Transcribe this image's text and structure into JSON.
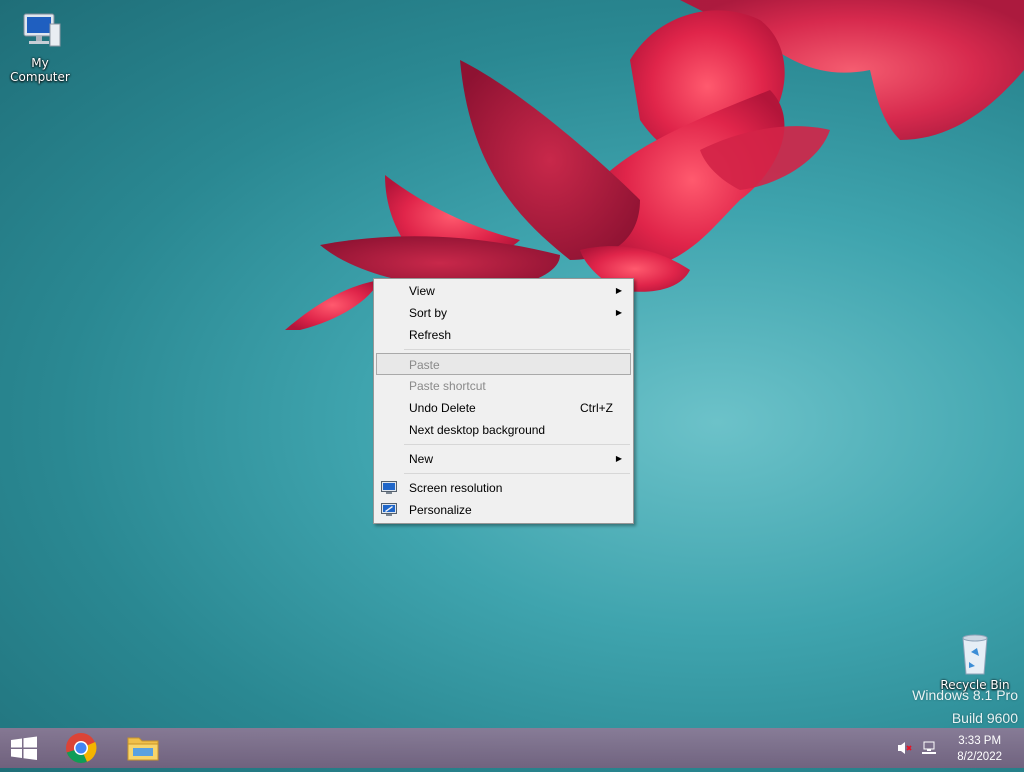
{
  "desktop": {
    "icons": [
      {
        "label": "My Computer"
      },
      {
        "label": "Recycle Bin"
      }
    ],
    "watermark": {
      "line1": "Windows 8.1 Pro",
      "line2": "Build 9600"
    }
  },
  "context_menu": {
    "items": [
      {
        "label": "View",
        "submenu": true
      },
      {
        "label": "Sort by",
        "submenu": true
      },
      {
        "label": "Refresh"
      },
      {
        "label": "Paste",
        "disabled": true,
        "highlighted": true
      },
      {
        "label": "Paste shortcut",
        "disabled": true
      },
      {
        "label": "Undo Delete",
        "shortcut": "Ctrl+Z"
      },
      {
        "label": "Next desktop background"
      },
      {
        "label": "New",
        "submenu": true
      },
      {
        "label": "Screen resolution",
        "icon": "monitor-icon"
      },
      {
        "label": "Personalize",
        "icon": "personalize-monitor-icon"
      }
    ],
    "submenu_arrow": "▶"
  },
  "taskbar": {
    "buttons": [
      {
        "name": "start",
        "icon": "windows-logo-icon"
      },
      {
        "name": "chrome",
        "icon": "chrome-icon"
      },
      {
        "name": "file-explorer",
        "icon": "folder-icon"
      }
    ],
    "tray": {
      "volume_icon": "volume-muted-icon",
      "network_icon": "network-icon"
    },
    "clock": {
      "time": "3:33 PM",
      "date": "8/2/2022"
    }
  },
  "colors": {
    "taskbar": "#8a6d8c",
    "menu_bg": "#f0f0f0",
    "highlight": "#e8e8e8"
  }
}
